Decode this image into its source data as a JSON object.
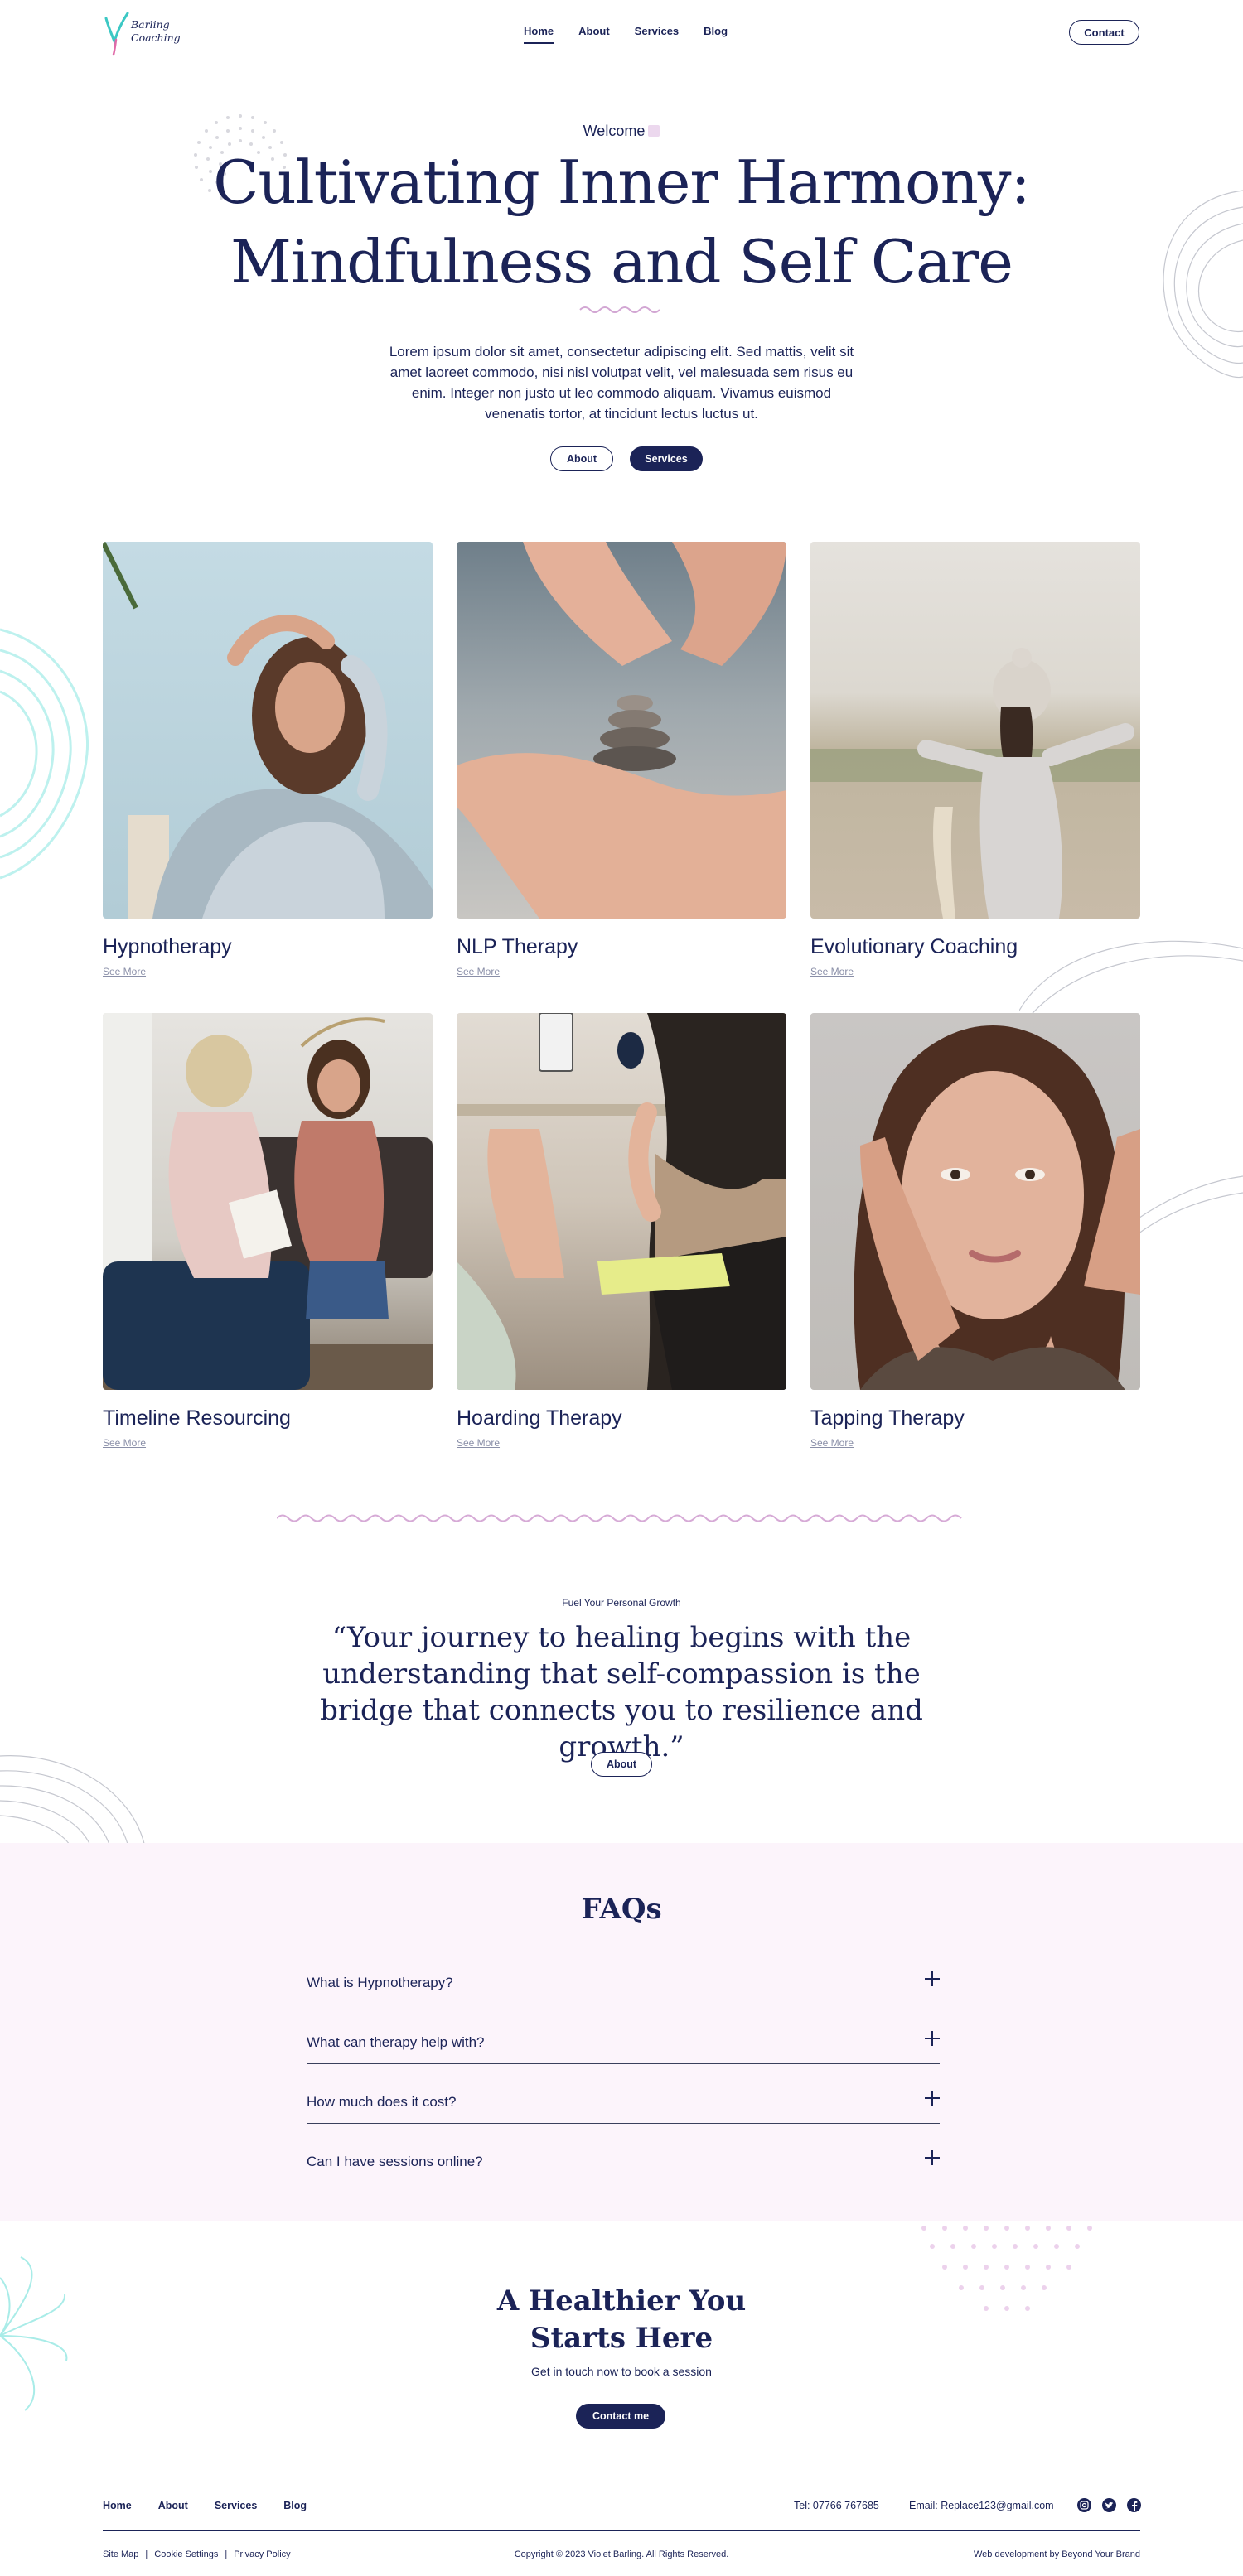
{
  "header": {
    "logo_line1": "Barling",
    "logo_line2": "Coaching",
    "nav": [
      "Home",
      "About",
      "Services",
      "Blog"
    ],
    "contact_label": "Contact"
  },
  "hero": {
    "welcome": "Welcome",
    "title_line1": "Cultivating Inner Harmony:",
    "title_line2": "Mindfulness and Self Care",
    "text": "Lorem ipsum dolor sit amet, consectetur adipiscing elit. Sed mattis, velit sit amet laoreet commodo, nisi nisl volutpat velit, vel malesuada sem risus eu enim. Integer non justo ut leo commodo aliquam. Vivamus euismod venenatis tortor, at tincidunt lectus luctus ut.",
    "about_label": "About",
    "services_label": "Services"
  },
  "services": [
    {
      "title": "Hypnotherapy",
      "link": "See More"
    },
    {
      "title": "NLP Therapy",
      "link": "See More"
    },
    {
      "title": "Evolutionary Coaching",
      "link": "See More"
    },
    {
      "title": "Timeline Resourcing",
      "link": "See More"
    },
    {
      "title": "Hoarding Therapy",
      "link": "See More"
    },
    {
      "title": "Tapping Therapy",
      "link": "See More"
    }
  ],
  "quote": {
    "eyebrow": "Fuel Your Personal Growth",
    "text": "“Your journey to healing begins with the understanding that self-compassion is the bridge that connects you to resilience and growth.”",
    "button": "About"
  },
  "faq": {
    "title": "FAQs",
    "items": [
      "What is Hypnotherapy?",
      "What can therapy help with?",
      "How much does it cost?",
      "Can I have sessions online?"
    ]
  },
  "cta": {
    "title_line1": "A Healthier You",
    "title_line2": "Starts Here",
    "subtitle": "Get in touch now to book a session",
    "button": "Contact me"
  },
  "footer": {
    "nav": [
      "Home",
      "About",
      "Services",
      "Blog"
    ],
    "tel": "Tel: 07766 767685",
    "email": "Email: Replace123@gmail.com",
    "social_icons": [
      "instagram-icon",
      "twitter-icon",
      "facebook-icon"
    ],
    "links": [
      "Site Map",
      "Cookie Settings",
      "Privacy Policy"
    ],
    "copyright": "Copyright © 2023 Violet Barling. All Rights Reserved.",
    "credit": "Web development by Beyond Your Brand"
  },
  "colors": {
    "navy": "#1b2357",
    "faq_bg": "#fcf4fb",
    "accent_pink": "#d9a7d6",
    "accent_teal": "#8ee3e0"
  }
}
